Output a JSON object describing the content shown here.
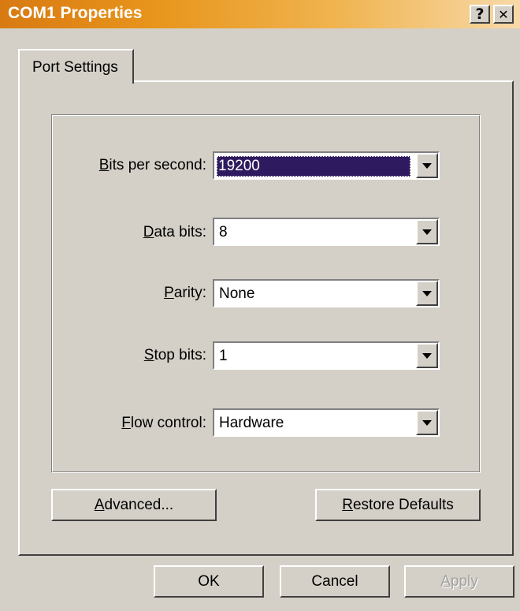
{
  "window": {
    "title": "COM1 Properties",
    "help_glyph": "?",
    "close_glyph": "✕"
  },
  "tabs": [
    {
      "label": "Port Settings",
      "selected": true
    }
  ],
  "fields": {
    "bits_per_second": {
      "label_u": "B",
      "label_rest": "its per second:",
      "value": "19200",
      "selected": true
    },
    "data_bits": {
      "label_u": "D",
      "label_rest": "ata bits:",
      "value": "8"
    },
    "parity": {
      "label_u": "P",
      "label_rest": "arity:",
      "value": "None"
    },
    "stop_bits": {
      "label_u": "S",
      "label_rest": "top bits:",
      "value": "1"
    },
    "flow_control": {
      "label_u": "F",
      "label_rest": "low control:",
      "value": "Hardware"
    }
  },
  "buttons": {
    "advanced_u": "A",
    "advanced_rest": "dvanced...",
    "restore_u": "R",
    "restore_rest": "estore Defaults",
    "ok": "OK",
    "cancel": "Cancel",
    "apply_u": "A",
    "apply_rest": "pply"
  },
  "colors": {
    "titlebar_start": "#d87a12",
    "titlebar_end": "#f7d9a8",
    "selection": "#2e1a5e",
    "face": "#d4d0c8"
  }
}
